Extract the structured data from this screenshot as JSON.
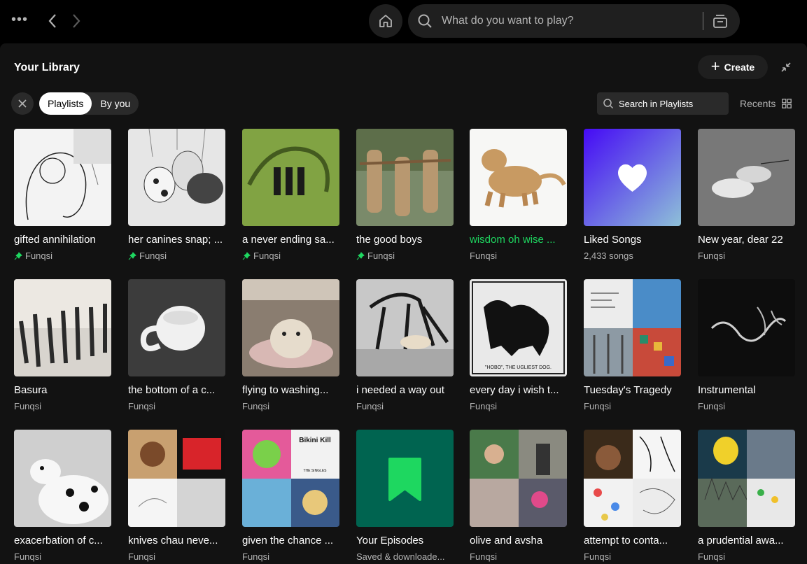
{
  "search": {
    "placeholder": "What do you want to play?"
  },
  "library": {
    "title": "Your Library",
    "create_label": "Create",
    "filters": [
      "Playlists",
      "By you"
    ],
    "search_label": "Search in Playlists",
    "sort_label": "Recents"
  },
  "colors": {
    "accent": "#1ed760",
    "panel": "#121212",
    "chip": "#2a2a2a"
  },
  "items": [
    {
      "title": "gifted annihilation",
      "subtitle": "Funqsi",
      "pinned": true
    },
    {
      "title": "her canines snap; ...",
      "subtitle": "Funqsi",
      "pinned": true
    },
    {
      "title": "a never ending sa...",
      "subtitle": "Funqsi",
      "pinned": true
    },
    {
      "title": "the good boys",
      "subtitle": "Funqsi",
      "pinned": true
    },
    {
      "title": "wisdom oh wise ...",
      "subtitle": "Funqsi",
      "pinned": false,
      "playing": true
    },
    {
      "title": "Liked Songs",
      "subtitle": "2,433 songs",
      "pinned": false
    },
    {
      "title": "New year, dear 22",
      "subtitle": "Funqsi",
      "pinned": false
    },
    {
      "title": "Basura",
      "subtitle": "Funqsi",
      "pinned": false
    },
    {
      "title": "the bottom of a c...",
      "subtitle": "Funqsi",
      "pinned": false
    },
    {
      "title": "flying to washing...",
      "subtitle": "Funqsi",
      "pinned": false
    },
    {
      "title": "i needed a way out",
      "subtitle": "Funqsi",
      "pinned": false
    },
    {
      "title": "every day i wish t...",
      "subtitle": "Funqsi",
      "pinned": false
    },
    {
      "title": "Tuesday's Tragedy",
      "subtitle": "Funqsi",
      "pinned": false
    },
    {
      "title": "Instrumental",
      "subtitle": "Funqsi",
      "pinned": false
    },
    {
      "title": "exacerbation of c...",
      "subtitle": "Funqsi",
      "pinned": false
    },
    {
      "title": "knives chau neve...",
      "subtitle": "Funqsi",
      "pinned": false
    },
    {
      "title": "given the chance ...",
      "subtitle": "Funqsi",
      "pinned": false
    },
    {
      "title": "Your Episodes",
      "subtitle": "Saved & downloade...",
      "pinned": false
    },
    {
      "title": "olive and avsha",
      "subtitle": "Funqsi",
      "pinned": false
    },
    {
      "title": "attempt to conta...",
      "subtitle": "Funqsi",
      "pinned": false
    },
    {
      "title": "a prudential awa...",
      "subtitle": "Funqsi",
      "pinned": false
    }
  ],
  "cover_text": {
    "hobo": "\"HOBO\", THE UGLIEST DOG.",
    "bikini": "Bikini Kill",
    "singles": "THE SINGLES"
  }
}
